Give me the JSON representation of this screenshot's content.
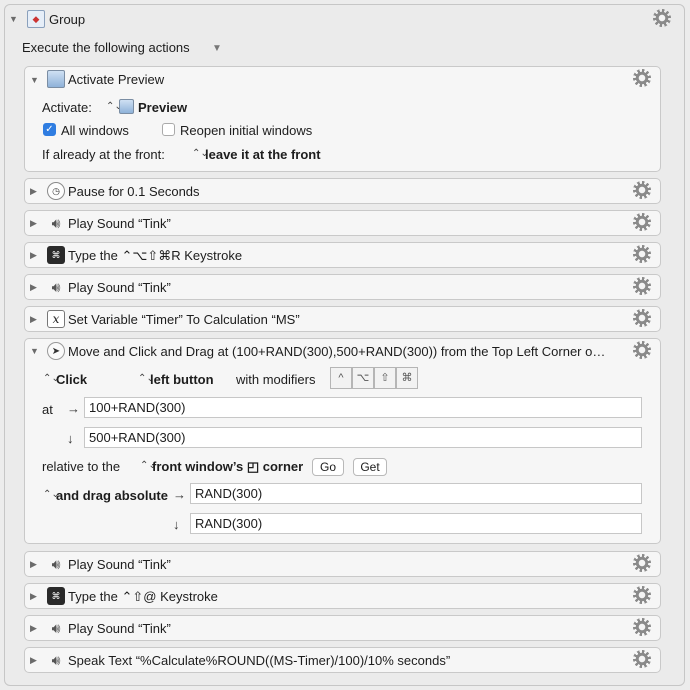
{
  "group": {
    "title": "Group",
    "execute_label": "Execute the following actions"
  },
  "activate_preview": {
    "title": "Activate Preview",
    "activate_label": "Activate:",
    "app_name": "Preview",
    "all_windows_label": "All windows",
    "all_windows_checked": true,
    "reopen_label": "Reopen initial windows",
    "reopen_checked": false,
    "front_label": "If already at the front:",
    "front_value": "leave it at the front"
  },
  "actions": {
    "pause": "Pause for 0.1 Seconds",
    "sound1": "Play Sound “Tink”",
    "type1": "Type the ⌃⌥⇧⌘R Keystroke",
    "sound2": "Play Sound “Tink”",
    "setvar": "Set Variable “Timer” To Calculation “MS”",
    "sound3": "Play Sound “Tink”",
    "type2": "Type the ⌃⇧@ Keystroke",
    "sound4": "Play Sound “Tink”",
    "speak": "Speak Text “%Calculate%ROUND((MS-Timer)/100)/10% seconds”"
  },
  "move_click": {
    "title": "Move and Click and Drag at (100+RAND(300),500+RAND(300)) from the Top Left Corner o…",
    "click_value": "Click",
    "button_value": "left button",
    "modifiers_label": "with modifiers",
    "modifier_keys": [
      "^",
      "⌥",
      "⇧",
      "⌘"
    ],
    "at_label": "at",
    "x_value": "100+RAND(300)",
    "y_value": "500+RAND(300)",
    "relative_label": "relative to the",
    "relative_value": "front window’s ◰ corner",
    "go_label": "Go",
    "get_label": "Get",
    "drag_value": "and drag absolute",
    "drag_x": "RAND(300)",
    "drag_y": "RAND(300)"
  },
  "icons": {
    "expand": "▼",
    "collapse": "▶",
    "popup": "⌃⌄",
    "right_arrow": "→",
    "down_arrow": "↓"
  }
}
